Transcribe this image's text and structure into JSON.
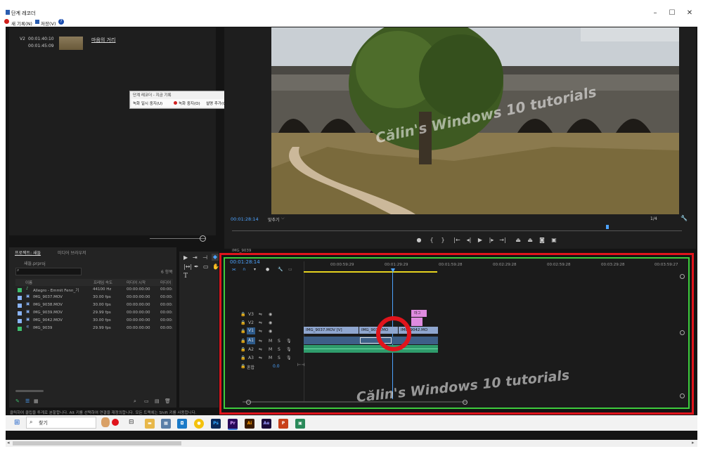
{
  "window": {
    "title": "단계 레코더",
    "toolbar": {
      "new_record": "새 기록(N)",
      "save": "저장(V)",
      "help": "?"
    }
  },
  "recorder_log": {
    "track": "V2",
    "time_in": "00:01:40:10",
    "time_out": "00:01:45:09",
    "clip_title": "마음의 거리"
  },
  "mini_recorder": {
    "title": "단계 레코더 - 지금 기록",
    "pause": "녹화 일시 중지(U)",
    "stop": "녹화 중지(O)",
    "add_comment": "설명 추가(C)",
    "help": "?"
  },
  "program_monitor": {
    "timecode": "00:01:28:14",
    "fit": "맞추기",
    "zoom": "1/4",
    "watermark": "Călin's Windows 10 tutorials"
  },
  "project_panel": {
    "tab_project": "프로젝트: 새들",
    "tab_media": "미디어 브라우저",
    "project_file": "새들.prproj",
    "item_count": "6 항목",
    "columns": [
      "이름",
      "프레임 속도",
      "미디어 시작",
      "미디어"
    ],
    "items": [
      {
        "name": "Allegro - Emmit Fenn_기",
        "rate": "44100 Hz",
        "start": "00:00:00:00",
        "end": "00:00:",
        "color": "#3fbf6e"
      },
      {
        "name": "IMG_9037.MOV",
        "rate": "30.00 fps",
        "start": "00:00:00:00",
        "end": "00:00:",
        "color": "#8ab4f8"
      },
      {
        "name": "IMG_9038.MOV",
        "rate": "30.00 fps",
        "start": "00:00:00:00",
        "end": "00:00:",
        "color": "#8ab4f8"
      },
      {
        "name": "IMG_9039.MOV",
        "rate": "29.99 fps",
        "start": "00:00:00:00",
        "end": "00:00:",
        "color": "#8ab4f8"
      },
      {
        "name": "IMG_9042.MOV",
        "rate": "30.00 fps",
        "start": "00:00:00:00",
        "end": "00:00:",
        "color": "#8ab4f8"
      },
      {
        "name": "IMG_9039",
        "rate": "29.99 fps",
        "start": "00:00:00:00",
        "end": "00:00:",
        "color": "#3fbf6e"
      }
    ]
  },
  "timeline": {
    "tab_label": "IMG_9039",
    "timecode": "00:01:28:14",
    "ruler": [
      "00:00:59:29",
      "00:01:29:29",
      "00:01:59:28",
      "00:02:29:28",
      "00:02:59:28",
      "00:03:29:28",
      "00:03:59:27"
    ],
    "tracks": [
      "V3",
      "V2",
      "V1",
      "A1",
      "A2",
      "A3"
    ],
    "mix_label": "혼합",
    "mix_value": "0.0",
    "clips": {
      "v1_a": "IMG_9037.MOV [V]",
      "v1_b": "IMG_9038.MO",
      "v1_c": "IMG_9042.MO",
      "v2_title": "마그"
    },
    "watermark": "Călin's Windows 10 tutorials"
  },
  "status_bar": {
    "text": "클릭하여 클립을 투게로 분할합니다. Alt 키를 선택하여 연결을 재정의합니다. 모든 트랙에는 Shift 키를 사용합니다."
  },
  "taskbar": {
    "search_placeholder": "찾기",
    "apps": [
      "Ps",
      "Pr",
      "Ai",
      "Ae"
    ]
  },
  "colors": {
    "highlight_red": "#e0141c",
    "highlight_green": "#3dcc3d",
    "premiere_blue": "#4da3ff",
    "clip_video": "#8fa6cf",
    "clip_audio": "#2f9c6c",
    "clip_title": "#e08be0"
  }
}
